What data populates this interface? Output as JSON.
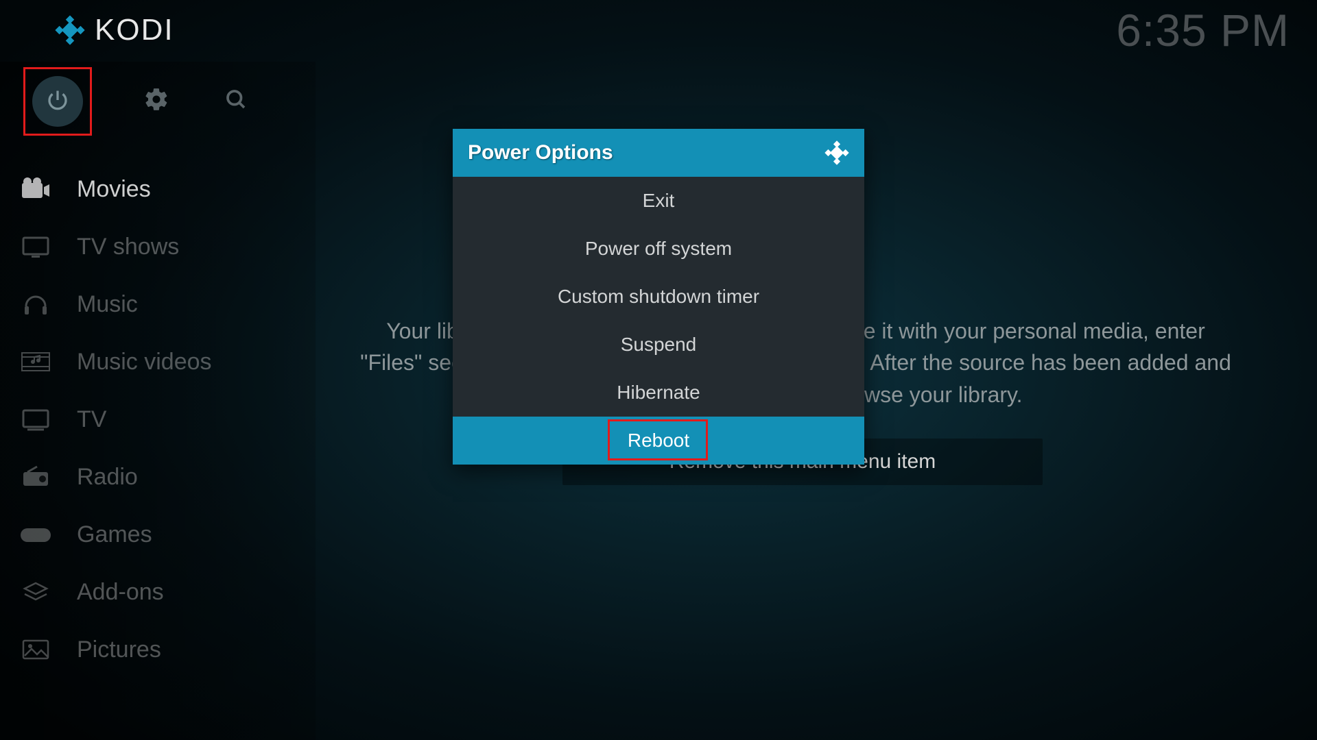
{
  "app": {
    "name": "KODI"
  },
  "clock": "6:35 PM",
  "sidebar": {
    "items": [
      {
        "label": "Movies"
      },
      {
        "label": "TV shows"
      },
      {
        "label": "Music"
      },
      {
        "label": "Music videos"
      },
      {
        "label": "TV"
      },
      {
        "label": "Radio"
      },
      {
        "label": "Games"
      },
      {
        "label": "Add-ons"
      },
      {
        "label": "Pictures"
      }
    ]
  },
  "main": {
    "info_line1": "Your library is currently empty. In order to populate it with your personal media, enter",
    "info_line2": "\"Files\" section, add a media source and configure it. After the source has been added and",
    "info_line3": "indexed you will be able to browse your library.",
    "remove_btn": "Remove this main menu item"
  },
  "dialog": {
    "title": "Power Options",
    "items": [
      {
        "label": "Exit"
      },
      {
        "label": "Power off system"
      },
      {
        "label": "Custom shutdown timer"
      },
      {
        "label": "Suspend"
      },
      {
        "label": "Hibernate"
      },
      {
        "label": "Reboot"
      }
    ],
    "selected_index": 5
  },
  "colors": {
    "accent": "#1390b6",
    "highlight": "#e21b1b"
  }
}
